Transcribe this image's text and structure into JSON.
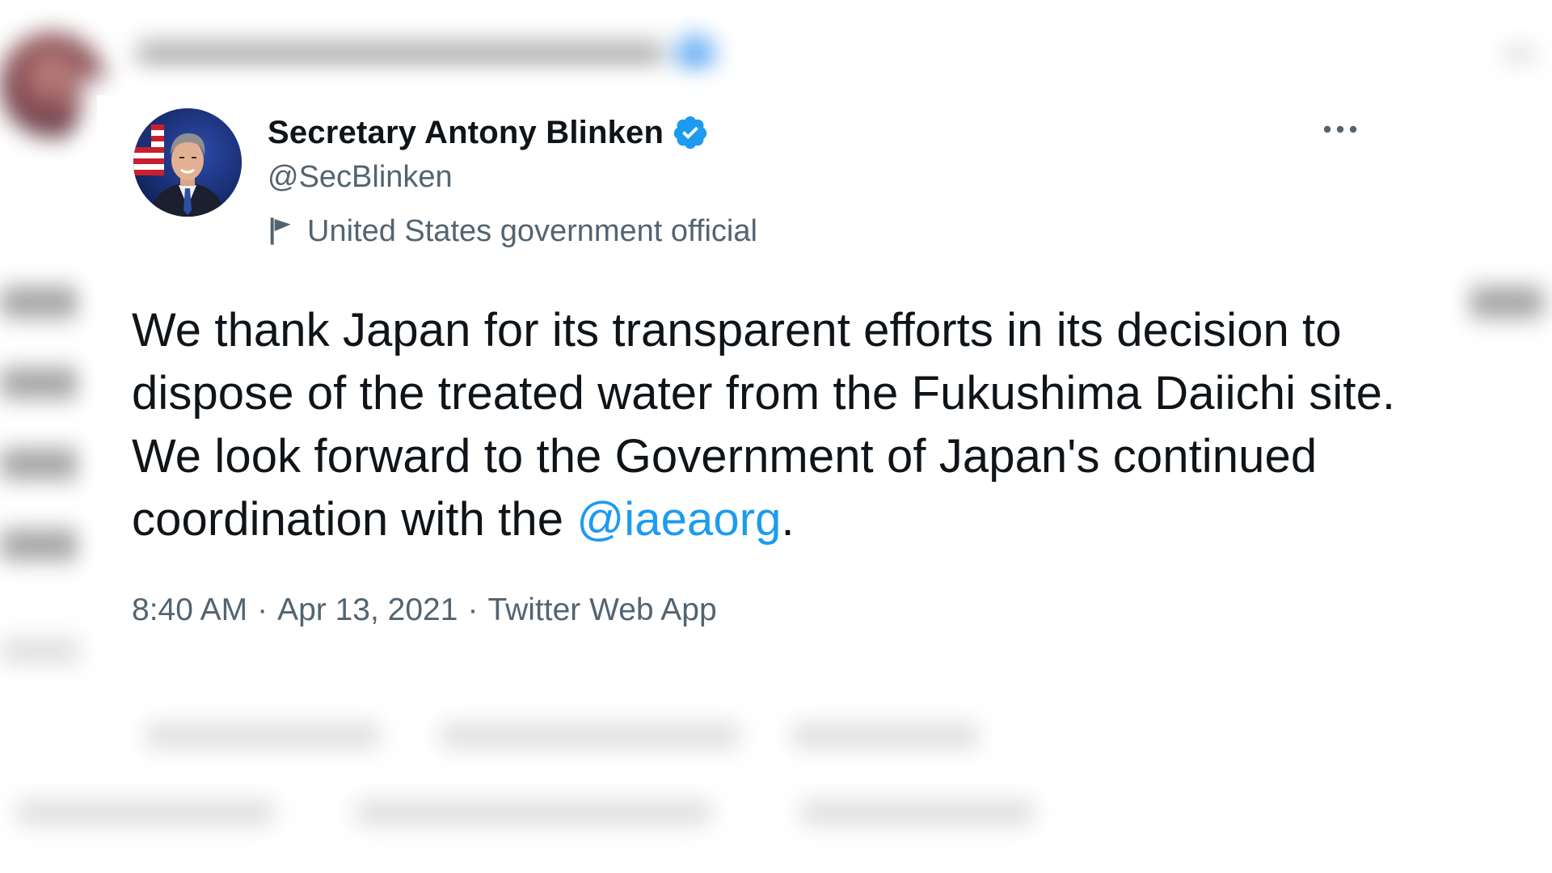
{
  "tweet": {
    "author_name": "Secretary Antony Blinken",
    "handle": "@SecBlinken",
    "account_label": "United States government official",
    "text_before": "We thank Japan for its transparent efforts in its decision to dispose of the treated water from the Fukushima Daiichi site. We look forward to the Government of Japan's continued coordination with the ",
    "mention": "@iaeaorg",
    "text_after": ".",
    "time": "8:40 AM",
    "date": "Apr 13, 2021",
    "separator": "·",
    "source_app": "Twitter Web App"
  },
  "icons": {
    "verified": "verified-badge-icon",
    "label": "flag-icon",
    "more": "more-options-icon"
  },
  "colors": {
    "text_primary": "#0f1419",
    "text_secondary": "#536471",
    "link": "#1d9bf0",
    "verified": "#1d9bf0"
  }
}
